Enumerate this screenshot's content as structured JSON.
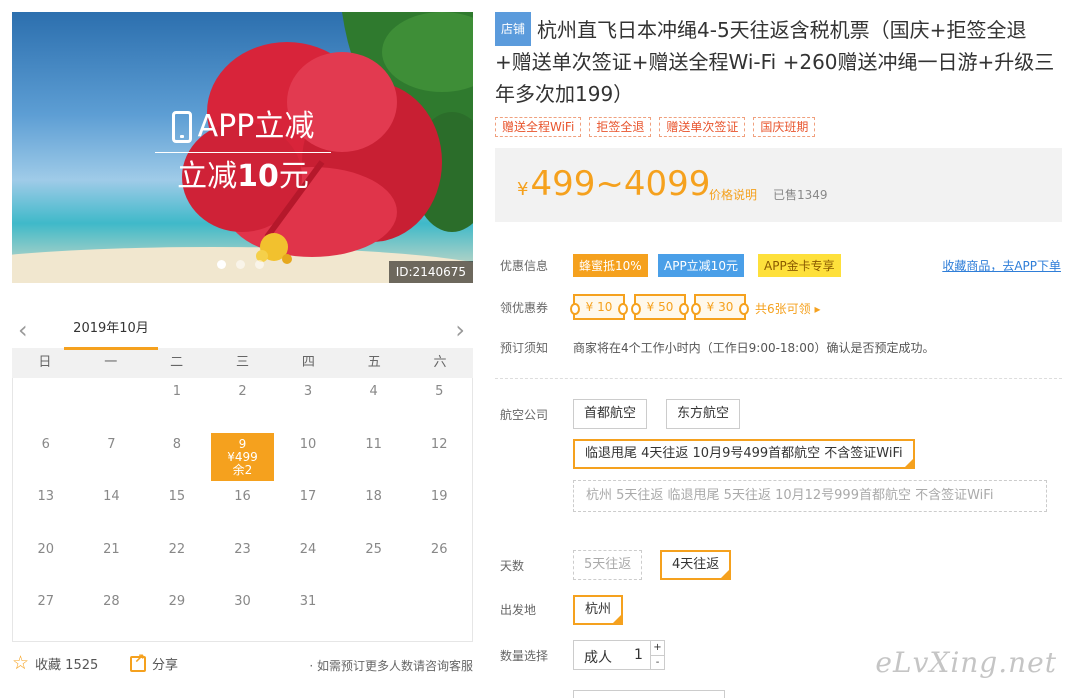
{
  "hero": {
    "promo_title": "APP立减",
    "promo_sub_prefix": "立减",
    "promo_sub_amount": "10",
    "promo_sub_suffix": "元",
    "image_id": "ID:2140675",
    "slide_count": 3,
    "active_slide": 1
  },
  "calendar": {
    "month_label": "2019年10月",
    "prev_icon": "chevron-left-icon",
    "next_icon": "chevron-right-icon",
    "weekdays": [
      "日",
      "一",
      "二",
      "三",
      "四",
      "五",
      "六"
    ],
    "days": [
      "",
      "",
      "1",
      "2",
      "3",
      "4",
      "5",
      "6",
      "7",
      "8",
      "9",
      "10",
      "11",
      "12",
      "13",
      "14",
      "15",
      "16",
      "17",
      "18",
      "19",
      "20",
      "21",
      "22",
      "23",
      "24",
      "25",
      "26",
      "27",
      "28",
      "29",
      "30",
      "31"
    ],
    "selected": {
      "day": "9",
      "price": "¥499",
      "remaining": "余2"
    }
  },
  "actions": {
    "favorite_label": "收藏 1525",
    "share_label": "分享",
    "consult_text": "· 如需预订更多人数请咨询客服"
  },
  "product": {
    "store_badge": "店铺",
    "title": "杭州直飞日本冲绳4-5天往返含税机票（国庆+拒签全退+赠送单次签证+赠送全程Wi-Fi +260赠送冲绳一日游+升级三年多次加199）",
    "tags": [
      "赠送全程WiFi",
      "拒签全退",
      "赠送单次签证",
      "国庆班期"
    ]
  },
  "price": {
    "currency": "¥",
    "range": "499~4099",
    "note_link": "价格说明",
    "sold": "已售1349"
  },
  "offers": {
    "label": "优惠信息",
    "items": [
      "蜂蜜抵10%",
      "APP立减10元",
      "APP金卡专享"
    ],
    "fav_link": "收藏商品，去APP下单"
  },
  "coupons": {
    "label": "领优惠券",
    "items": [
      "¥ 10",
      "¥ 50",
      "¥ 30"
    ],
    "more": "共6张可领 ▸"
  },
  "booking_notice": {
    "label": "预订须知",
    "text": "商家将在4个工作小时内（工作日9:00-18:00）确认是否预定成功。"
  },
  "airline": {
    "label": "航空公司",
    "options": [
      "首都航空",
      "东方航空"
    ],
    "packages": [
      "临退甩尾 4天往返 10月9号499首都航空 不含签证WiFi",
      "杭州 5天往返 临退甩尾 5天往返 10月12号999首都航空 不含签证WiFi"
    ]
  },
  "days_opt": {
    "label": "天数",
    "options": [
      "5天往返",
      "4天往返"
    ]
  },
  "departure": {
    "label": "出发地",
    "value": "杭州"
  },
  "quantity": {
    "label": "数量选择",
    "type": "成人",
    "value": "1",
    "plus": "+",
    "minus": "-"
  },
  "watermark": "eLvXing.net",
  "colors": {
    "accent": "#f5a11e",
    "link": "#2f7ed8",
    "store": "#5b9bdc"
  }
}
